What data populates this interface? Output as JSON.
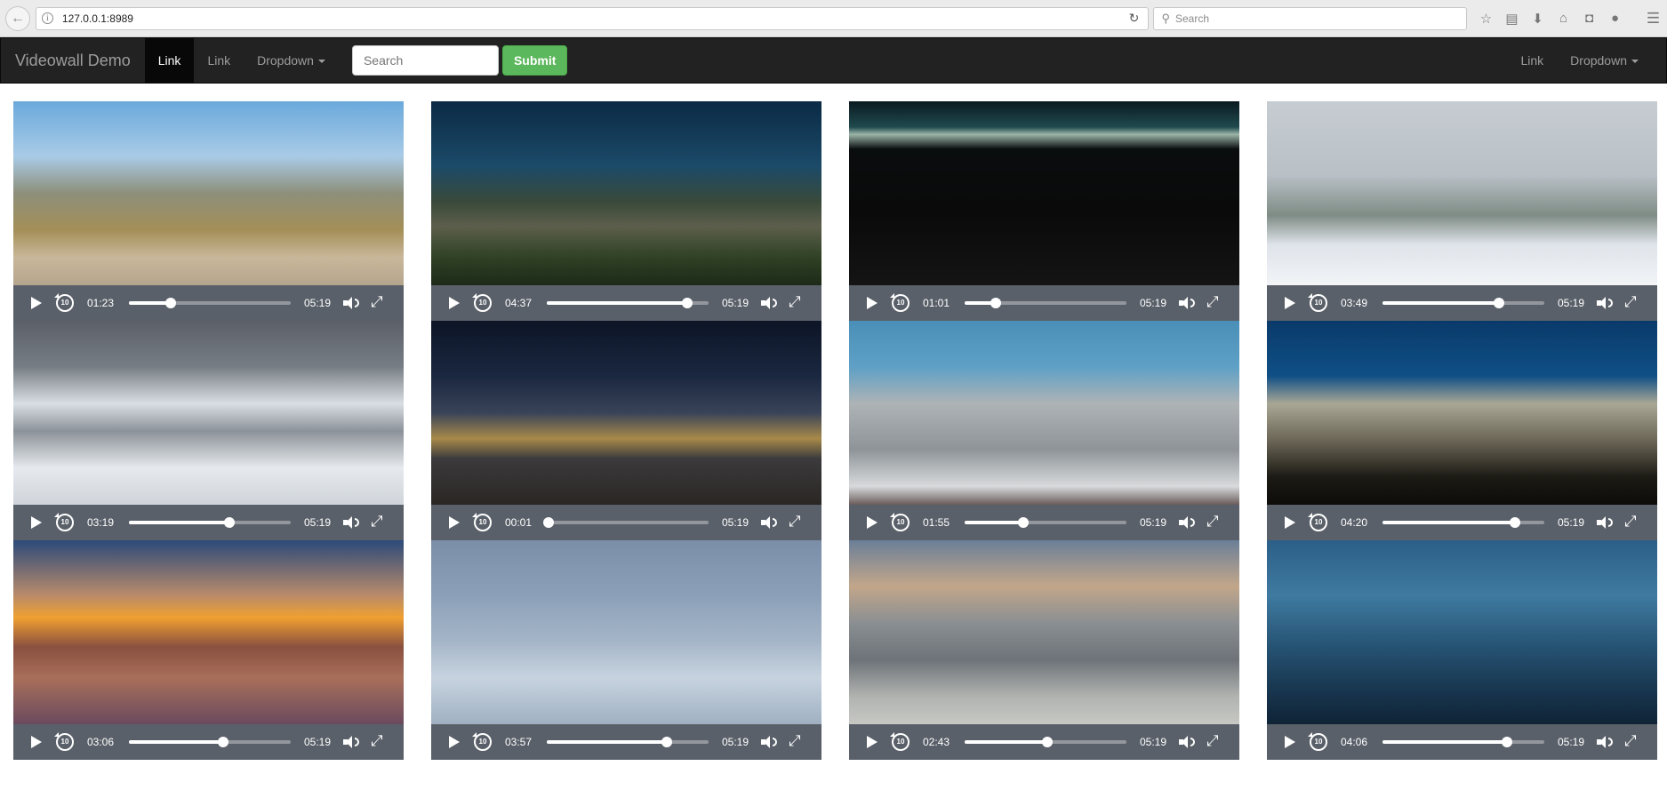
{
  "browser": {
    "url": "127.0.0.1:8989",
    "search_placeholder": "Search"
  },
  "navbar": {
    "brand": "Videowall Demo",
    "left_links": [
      {
        "label": "Link",
        "active": true
      },
      {
        "label": "Link",
        "active": false
      }
    ],
    "dropdown_left": "Dropdown",
    "search_placeholder": "Search",
    "submit_label": "Submit",
    "right_link": "Link",
    "dropdown_right": "Dropdown"
  },
  "videos": [
    {
      "current": "01:23",
      "duration": "05:19",
      "progress": 0.26
    },
    {
      "current": "04:37",
      "duration": "05:19",
      "progress": 0.87
    },
    {
      "current": "01:01",
      "duration": "05:19",
      "progress": 0.19
    },
    {
      "current": "03:49",
      "duration": "05:19",
      "progress": 0.72
    },
    {
      "current": "03:19",
      "duration": "05:19",
      "progress": 0.62
    },
    {
      "current": "00:01",
      "duration": "05:19",
      "progress": 0.01
    },
    {
      "current": "01:55",
      "duration": "05:19",
      "progress": 0.36
    },
    {
      "current": "04:20",
      "duration": "05:19",
      "progress": 0.82
    },
    {
      "current": "03:06",
      "duration": "05:19",
      "progress": 0.58
    },
    {
      "current": "03:57",
      "duration": "05:19",
      "progress": 0.74
    },
    {
      "current": "02:43",
      "duration": "05:19",
      "progress": 0.51
    },
    {
      "current": "04:06",
      "duration": "05:19",
      "progress": 0.77
    }
  ]
}
